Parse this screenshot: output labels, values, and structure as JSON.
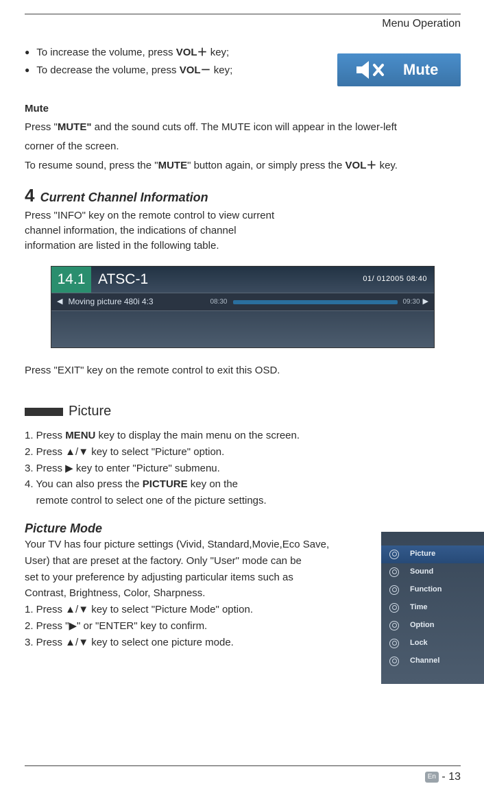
{
  "header": {
    "section": "Menu Operation"
  },
  "volume": {
    "increase_prefix": "To increase the volume, press ",
    "increase_key": "VOL",
    "increase_sym": "＋",
    "increase_suffix": " key;",
    "decrease_prefix": "To decrease the volume, press ",
    "decrease_key": "VOL",
    "decrease_sym": "－",
    "decrease_suffix": " key;"
  },
  "mute_badge": {
    "label": "Mute"
  },
  "mute": {
    "heading": "Mute",
    "p1_a": "Press \"",
    "p1_b": "MUTE\"",
    "p1_c": " and the sound cuts off. The MUTE icon will appear in the lower-left",
    "p2": "corner of the screen.",
    "p3_a": "To resume sound, press the \"",
    "p3_b": "MUTE",
    "p3_c": "\" button again, or simply press the ",
    "p3_d": "VOL",
    "p3_sym": "＋",
    "p3_e": " key."
  },
  "section4": {
    "num": "4",
    "title": "Current Channel Information",
    "p1": "Press \"INFO\" key on the remote control to view current",
    "p2": "channel information, the indications of channel",
    "p3": "information are listed in the following table."
  },
  "osd": {
    "ch_num": "14.1",
    "ch_name": "ATSC-1",
    "datetime": "01/ 012005 08:40",
    "program": "Moving picture 480i 4:3",
    "t_start": "08:30",
    "t_end": "09:30"
  },
  "exit": "Press \"EXIT\" key on the remote control to exit this OSD.",
  "picture": {
    "label": "Picture",
    "s1_a": "1. Press ",
    "s1_b": "MENU",
    "s1_c": " key to display the main menu on the screen.",
    "s2": "2. Press ▲/▼ key to select \"Picture\" option.",
    "s3": "3. Press ▶ key to enter \"Picture\" submenu.",
    "s4_a": "4. You can also press the ",
    "s4_b": "PICTURE",
    "s4_c": " key on the",
    "s4_d": "    remote control to select one of the picture settings."
  },
  "picture_mode": {
    "heading": "Picture Mode",
    "p1": "Your TV has four picture settings (Vivid, Standard,Movie,Eco Save,",
    "p2": "User) that are preset at the factory. Only \"User\" mode can be",
    "p3": "set to your preference by adjusting particular items such as",
    "p4": "Contrast, Brightness, Color, Sharpness.",
    "s1": "1. Press ▲/▼ key to select \"Picture Mode\" option.",
    "s2": "2. Press \"▶\" or \"ENTER\" key to confirm.",
    "s3": "3. Press ▲/▼ key to select one picture mode."
  },
  "menu_osd": {
    "items": [
      {
        "label": "Picture",
        "active": true
      },
      {
        "label": "Sound",
        "active": false
      },
      {
        "label": "Function",
        "active": false
      },
      {
        "label": "Time",
        "active": false
      },
      {
        "label": "Option",
        "active": false
      },
      {
        "label": "Lock",
        "active": false
      },
      {
        "label": "Channel",
        "active": false
      }
    ]
  },
  "footer": {
    "lang": "En",
    "sep": " - ",
    "page": "13"
  }
}
